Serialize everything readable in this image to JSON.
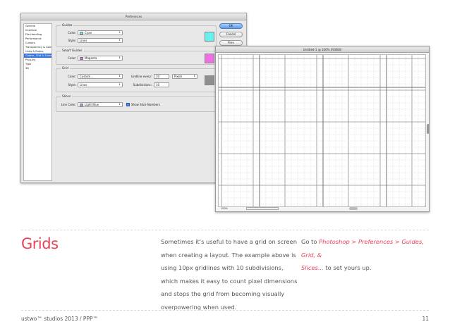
{
  "preferences": {
    "title": "Preferences",
    "sidebar": [
      "General",
      "Interface",
      "File Handling",
      "Performance",
      "Cursors",
      "Transparency & Gamut",
      "Units & Rulers",
      "Guides, Grid & Slices",
      "Plug-Ins",
      "Type",
      "3D"
    ],
    "sidebar_selected": 7,
    "guides": {
      "label": "Guides",
      "color_label": "Color:",
      "color_value": "Cyan",
      "color_hex": "#66f0ee",
      "style_label": "Style:",
      "style_value": "Lines"
    },
    "smart_guides": {
      "label": "Smart Guides",
      "color_label": "Color:",
      "color_value": "Magenta",
      "color_hex": "#f06ee6"
    },
    "grid": {
      "label": "Grid",
      "color_label": "Color:",
      "color_value": "Custom...",
      "color_hex": "#8f8f8f",
      "style_label": "Style:",
      "style_value": "Lines",
      "gridline_label": "Gridline every:",
      "gridline_value": "10",
      "gridline_unit": "Pixels",
      "subdiv_label": "Subdivisions:",
      "subdiv_value": "10"
    },
    "slices": {
      "label": "Slices",
      "line_color_label": "Line Color:",
      "line_color_value": "Light Blue",
      "line_color_hex": "#8fb2ea",
      "show_numbers_label": "Show Slice Numbers"
    },
    "buttons": {
      "ok": "OK",
      "cancel": "Cancel",
      "prev": "Prev",
      "next": "Next"
    }
  },
  "document": {
    "title": "Untitled-1 @ 100% (RGB/8)",
    "zoom": "100%"
  },
  "section": {
    "heading": "Grids",
    "body1": [
      "Sometimes it's useful to have a grid on screen",
      "when creating a layout. The example above is",
      "using 10px gridlines with 10 subdivisions,",
      "which makes it easy to count pixel dimensions",
      "and stops the grid from becoming visually",
      "overpowering when used."
    ],
    "body2_prefix": "Go to ",
    "body2_path_line1": "Photoshop > Preferences > Guides, Grid, &",
    "body2_path_line2": "Slices...",
    "body2_suffix": " to set yours up."
  },
  "footer": {
    "left": "ustwo™ studios 2013  /  PPP™",
    "page_number": "11"
  }
}
